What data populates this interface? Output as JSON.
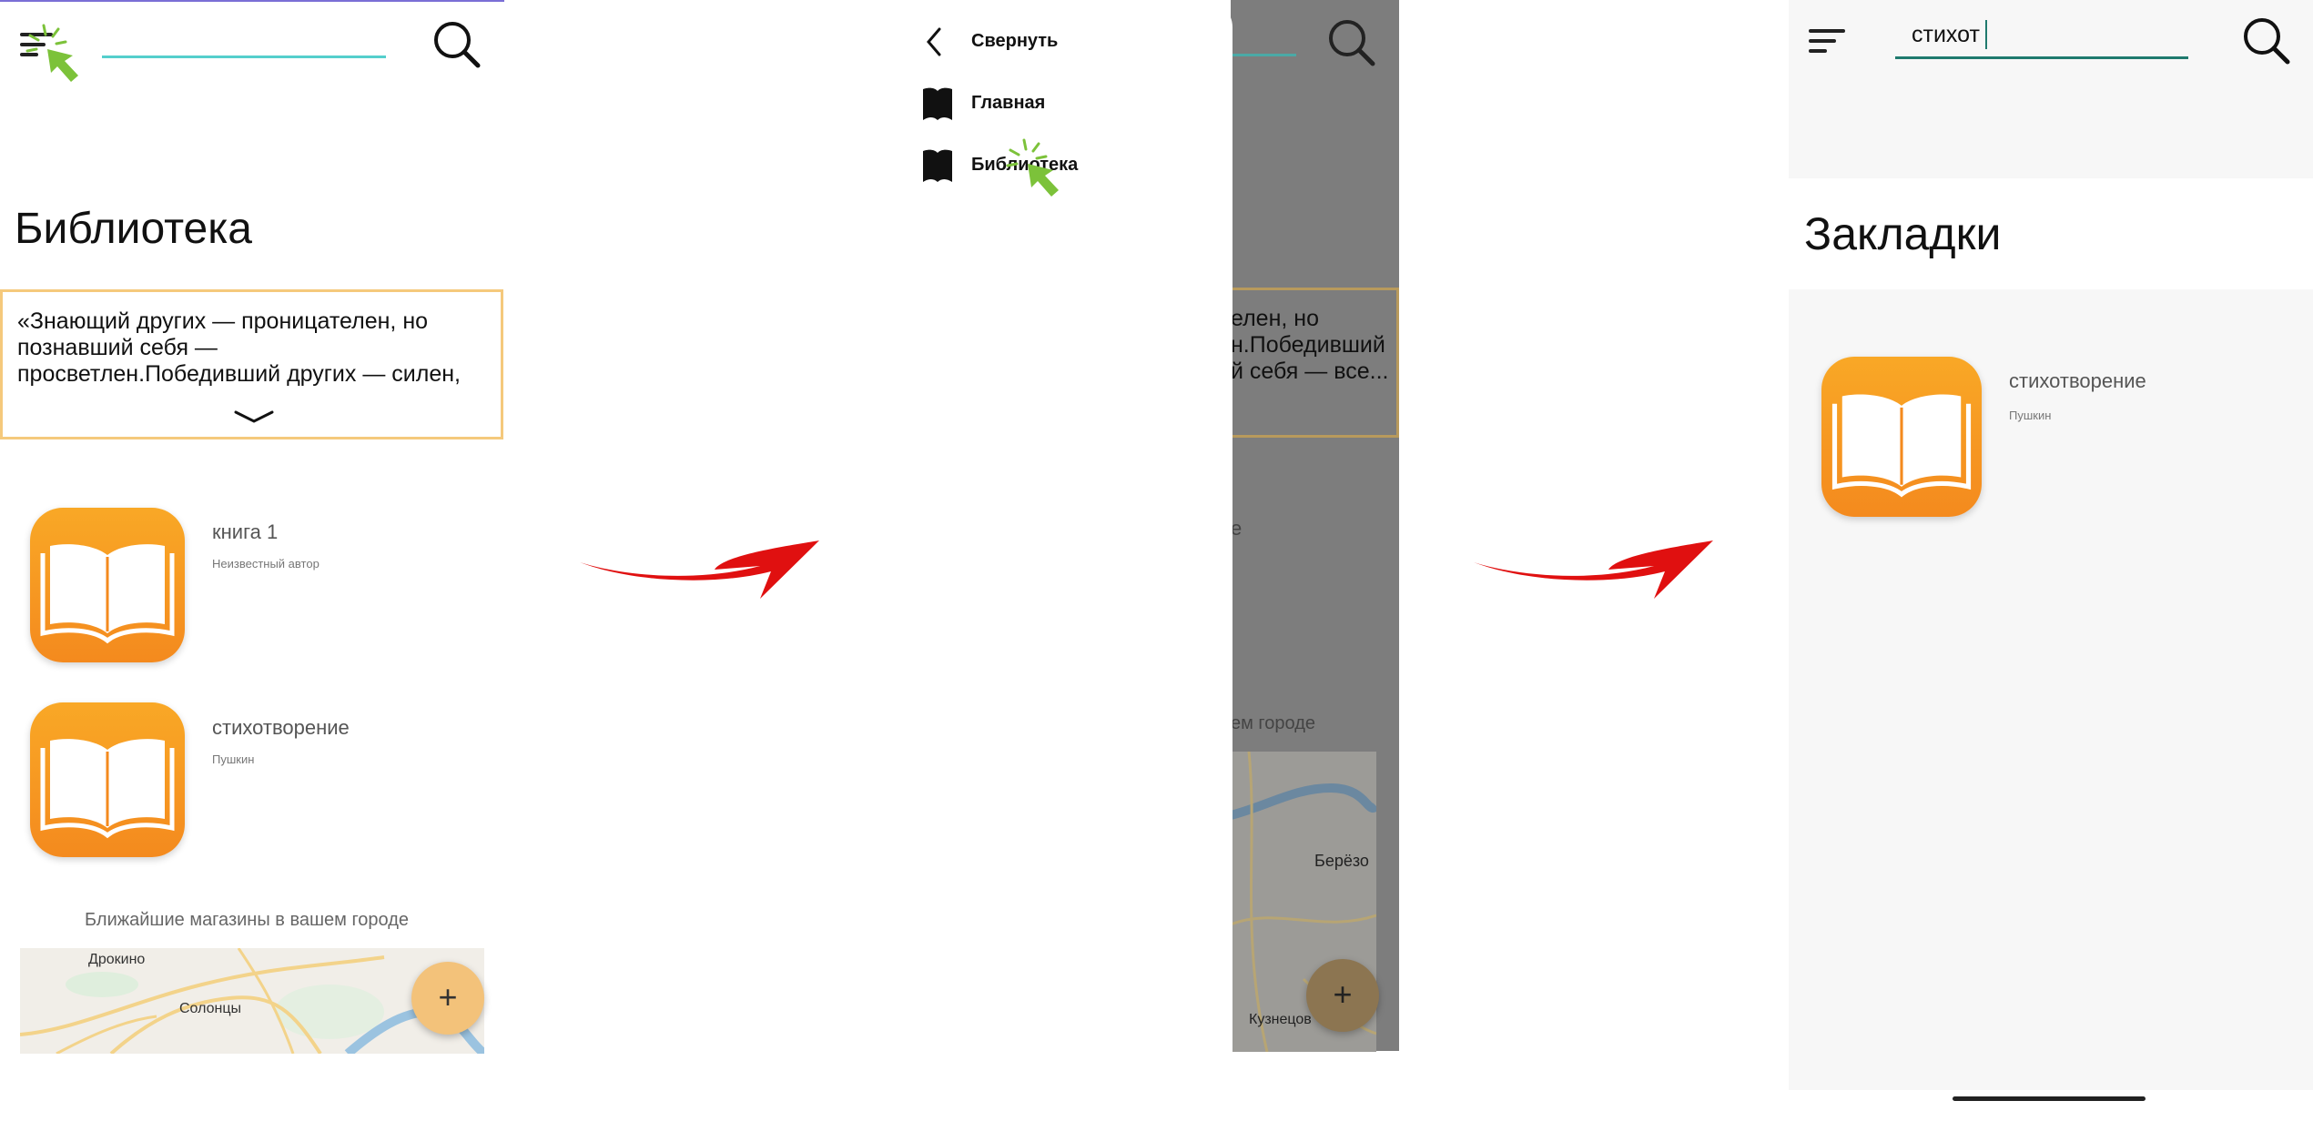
{
  "panel1": {
    "title": "Библиотека",
    "quote": "«Знающий других — проницателен, но познавший себя — просветлен.Победивший других — силен, но победивший себя — все...",
    "books": [
      {
        "title": "книга 1",
        "author": "Неизвестный автор"
      },
      {
        "title": "стихотворение",
        "author": "Пушкин"
      }
    ],
    "stores_label": "Ближайшие магазины в вашем городе",
    "map_labels": [
      "Дрокино",
      "Солонцы"
    ],
    "fab_label": "+"
  },
  "panel2": {
    "collapse_label": "Свернуть",
    "menu_items": [
      {
        "label": "Главная"
      },
      {
        "label": "Библиотека"
      }
    ],
    "bg_quote_lines": [
      "елен, но",
      "й себя — все..."
    ],
    "bg_quote_middle": "н.Победивший",
    "bg_book_fragment": "е",
    "bg_stores_fragment": "ем городе",
    "bg_map_labels": [
      "Берёзо",
      "Кузнецов"
    ],
    "fab_label": "+"
  },
  "panel3": {
    "search_value": "стихот",
    "title": "Закладки",
    "bookmarks": [
      {
        "title": "стихотворение",
        "author": "Пушкин"
      }
    ]
  },
  "colors": {
    "accent_teal": "#55cfcc",
    "quote_border": "#f5c97c",
    "book_icon_orange": "#f48a1e",
    "fab": "#f3c27a",
    "cursor_green": "#7cc23a",
    "arrow_red": "#e01010"
  },
  "icons": [
    "menu-icon",
    "search-icon",
    "book-icon",
    "chevron-down-icon",
    "chevron-left-icon",
    "bookmark-icon",
    "cursor-icon",
    "plus-icon"
  ]
}
